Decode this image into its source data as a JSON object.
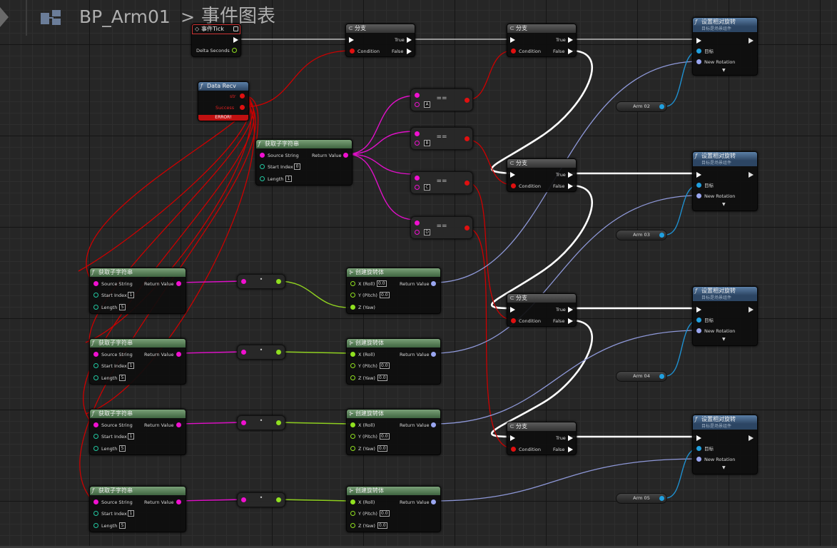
{
  "breadcrumb": {
    "blueprint": "BP_Arm01",
    "separator": ">",
    "graph": "事件图表"
  },
  "tick": {
    "title": "事件Tick",
    "delta": "Delta Seconds"
  },
  "branch": {
    "title": "分支",
    "true_label": "True",
    "false_label": "False",
    "condition": "Condition"
  },
  "data_recv": {
    "title": "Data Recv",
    "str_pin": "str",
    "success_pin": "Success",
    "error": "ERROR!"
  },
  "substring": {
    "title": "获取子字符串",
    "source": "Source String",
    "start": "Start Index",
    "length": "Length",
    "ret": "Return Value"
  },
  "main_substring": {
    "start": "0",
    "length": "1"
  },
  "row_substrings": [
    {
      "start": "1",
      "length": "5"
    },
    {
      "start": "1",
      "length": "5"
    },
    {
      "start": "1",
      "length": "5"
    },
    {
      "start": "1",
      "length": "5"
    }
  ],
  "equals": {
    "op": "==",
    "letters": [
      "A",
      "B",
      "C",
      "D"
    ]
  },
  "convert_op": "•",
  "make_rot": {
    "title": "创建旋转体",
    "x": "X (Roll)",
    "y": "Y (Pitch)",
    "z": "Z (Yaw)",
    "ret": "Return Value",
    "default": "0.0"
  },
  "set_rot": {
    "title": "设置相对旋转",
    "subtitle": "目标是场景组件",
    "target": "目标",
    "new_rot": "New Rotation"
  },
  "arms": [
    "Arm 02",
    "Arm 03",
    "Arm 04",
    "Arm 05"
  ],
  "colors": {
    "exec": "#ffffff",
    "bool": "#e01010",
    "string": "#f010d0",
    "int": "#22c7a0",
    "float": "#90e020",
    "rotator": "#9aa6f0",
    "object": "#20a0e0"
  }
}
